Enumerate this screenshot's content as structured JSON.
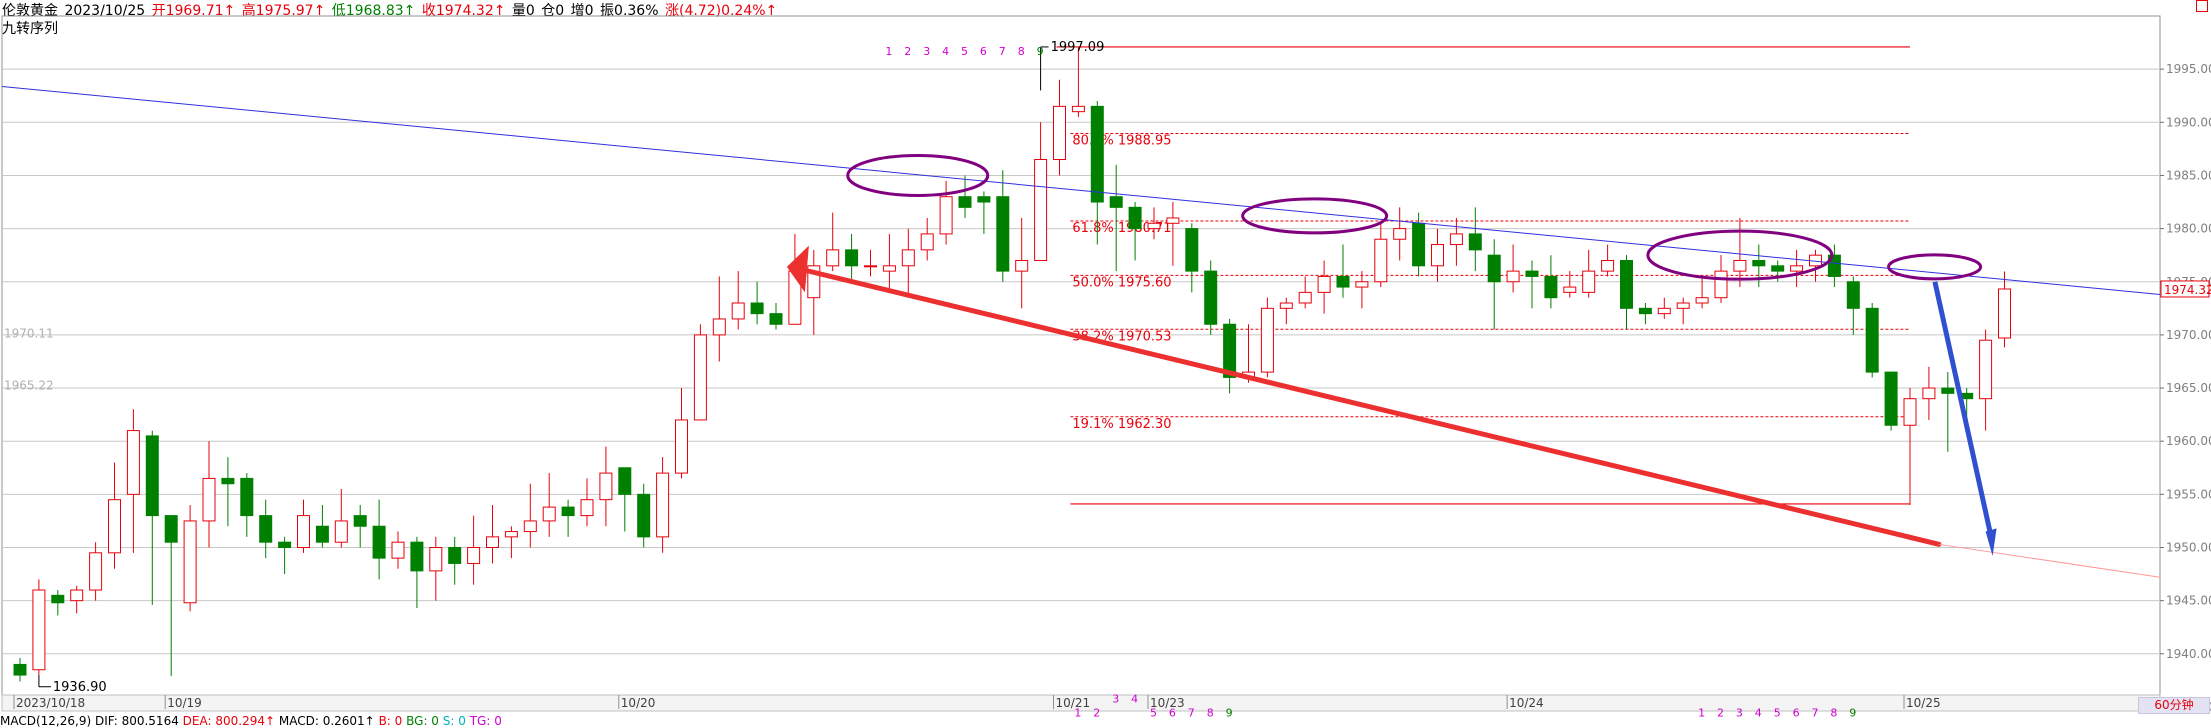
{
  "header": {
    "name": "伦敦黄金",
    "date": "2023/10/25",
    "open": "开1969.71↑",
    "high": "高1975.97↑",
    "low": "低1968.83↑",
    "close": "收1974.32↑",
    "volume": "量0",
    "position": "仓0",
    "increase": "增0",
    "amplitude": "振0.36%",
    "change": "涨(4.72)0.24%↑",
    "indicator": "九转序列"
  },
  "footer": {
    "macd": "MACD(12,26,9)",
    "dif": "DIF: 800.5164",
    "dea": "DEA: 800.294↑",
    "macd_val": "MACD: 0.2601↑",
    "b": "B: 0",
    "bg": "BG: 0",
    "s": "S: 0",
    "tg": "TG: 0"
  },
  "timeframe": "60分钟",
  "colors": {
    "up": "#e8000b",
    "down": "#008000",
    "trendline": "#3030e0",
    "ellipse": "#800080",
    "fib": "#e8000b",
    "seq_up": "#d000d0",
    "seq_down": "#008000"
  },
  "chart_data": {
    "type": "candlestick",
    "symbol": "伦敦黄金",
    "interval": "60分钟",
    "ylim": [
      1933.0,
      2000.0
    ],
    "y_ticks": [
      1935.0,
      1940.0,
      1945.0,
      1950.0,
      1955.0,
      1960.0,
      1965.0,
      1970.0,
      1975.0,
      1980.0,
      1985.0,
      1990.0,
      1995.0
    ],
    "x_labels": [
      {
        "i": 0,
        "label": "2023/10/18"
      },
      {
        "i": 8,
        "label": "10/19"
      },
      {
        "i": 32,
        "label": "10/20"
      },
      {
        "i": 55,
        "label": "10/21"
      },
      {
        "i": 60,
        "label": "10/23"
      },
      {
        "i": 79,
        "label": "10/24"
      },
      {
        "i": 100,
        "label": "10/25"
      }
    ],
    "candles": [
      [
        1939.0,
        1938.0,
        1939.6,
        1937.4
      ],
      [
        1938.5,
        1946.0,
        1947.0,
        1938.0
      ],
      [
        1945.5,
        1944.8,
        1946.0,
        1943.6
      ],
      [
        1945.0,
        1946.0,
        1946.4,
        1943.8
      ],
      [
        1946.0,
        1949.5,
        1950.5,
        1945.0
      ],
      [
        1949.5,
        1954.5,
        1958.0,
        1948.0
      ],
      [
        1955.0,
        1961.0,
        1963.0,
        1949.5
      ],
      [
        1960.5,
        1953.0,
        1961.0,
        1944.6
      ],
      [
        1953.0,
        1950.5,
        1952.0,
        1937.9
      ],
      [
        1944.8,
        1952.5,
        1954.0,
        1944.0
      ],
      [
        1952.5,
        1956.5,
        1960.0,
        1950.0
      ],
      [
        1956.5,
        1956.0,
        1958.5,
        1952.0
      ],
      [
        1956.5,
        1953.0,
        1957.0,
        1951.0
      ],
      [
        1953.0,
        1950.5,
        1954.5,
        1949.0
      ],
      [
        1950.5,
        1950.0,
        1951.0,
        1947.5
      ],
      [
        1950.0,
        1953.0,
        1954.5,
        1949.5
      ],
      [
        1952.0,
        1950.5,
        1954.0,
        1950.0
      ],
      [
        1950.5,
        1952.5,
        1955.5,
        1950.0
      ],
      [
        1953.0,
        1952.0,
        1954.0,
        1950.0
      ],
      [
        1952.0,
        1949.0,
        1954.5,
        1947.0
      ],
      [
        1949.0,
        1950.5,
        1951.5,
        1948.0
      ],
      [
        1950.5,
        1947.8,
        1951.0,
        1944.3
      ],
      [
        1947.8,
        1950.0,
        1951.0,
        1945.0
      ],
      [
        1950.0,
        1948.5,
        1951.0,
        1946.5
      ],
      [
        1948.5,
        1950.0,
        1953.0,
        1946.5
      ],
      [
        1950.0,
        1951.0,
        1954.0,
        1948.5
      ],
      [
        1951.0,
        1951.5,
        1952.0,
        1949.0
      ],
      [
        1951.5,
        1952.5,
        1956.0,
        1950.0
      ],
      [
        1952.5,
        1953.8,
        1957.0,
        1951.0
      ],
      [
        1953.8,
        1953.0,
        1954.5,
        1951.0
      ],
      [
        1953.0,
        1954.5,
        1956.5,
        1952.0
      ],
      [
        1954.5,
        1957.0,
        1959.5,
        1952.0
      ],
      [
        1957.5,
        1955.0,
        1957.5,
        1951.5
      ],
      [
        1955.0,
        1951.0,
        1956.0,
        1950.0
      ],
      [
        1951.0,
        1957.0,
        1958.5,
        1949.5
      ],
      [
        1957.0,
        1962.0,
        1965.0,
        1956.5
      ],
      [
        1962.0,
        1970.0,
        1971.0,
        1962.0
      ],
      [
        1970.0,
        1971.5,
        1975.5,
        1967.5
      ],
      [
        1971.5,
        1973.0,
        1976.0,
        1970.5
      ],
      [
        1973.0,
        1972.0,
        1975.0,
        1971.0
      ],
      [
        1972.0,
        1971.0,
        1973.0,
        1970.5
      ],
      [
        1971.0,
        1976.0,
        1979.5,
        1971.0
      ],
      [
        1973.5,
        1976.5,
        1978.0,
        1970.0
      ],
      [
        1976.5,
        1978.0,
        1981.5,
        1976.0
      ],
      [
        1978.0,
        1976.5,
        1979.5,
        1975.0
      ],
      [
        1976.5,
        1976.5,
        1978.0,
        1975.5
      ],
      [
        1976.0,
        1976.5,
        1979.5,
        1974.0
      ],
      [
        1976.5,
        1978.0,
        1980.0,
        1973.5
      ],
      [
        1978.0,
        1979.5,
        1981.0,
        1977.0
      ],
      [
        1979.5,
        1983.0,
        1984.5,
        1978.5
      ],
      [
        1983.0,
        1982.0,
        1985.0,
        1981.0
      ],
      [
        1983.0,
        1982.5,
        1983.5,
        1979.5
      ],
      [
        1983.0,
        1976.0,
        1985.5,
        1975.0
      ],
      [
        1976.0,
        1977.0,
        1981.0,
        1972.5
      ],
      [
        1977.0,
        1986.5,
        1990.0,
        1977.5
      ],
      [
        1986.5,
        1991.5,
        1994.0,
        1985.0
      ],
      [
        1991.0,
        1991.5,
        1997.09,
        1990.5
      ],
      [
        1991.5,
        1982.5,
        1992.0,
        1978.5
      ],
      [
        1983.0,
        1982.0,
        1986.0,
        1976.0
      ],
      [
        1982.0,
        1980.0,
        1982.5,
        1977.0
      ],
      [
        1980.0,
        1980.5,
        1982.0,
        1979.0
      ],
      [
        1980.5,
        1981.0,
        1982.5,
        1976.5
      ],
      [
        1980.0,
        1976.0,
        1980.5,
        1974.0
      ],
      [
        1976.0,
        1971.0,
        1977.0,
        1970.0
      ],
      [
        1971.0,
        1966.0,
        1971.5,
        1964.5
      ],
      [
        1966.0,
        1966.5,
        1971.0,
        1965.5
      ],
      [
        1966.5,
        1972.5,
        1973.5,
        1966.0
      ],
      [
        1972.5,
        1973.0,
        1973.5,
        1971.0
      ],
      [
        1973.0,
        1974.0,
        1975.5,
        1972.5
      ],
      [
        1974.0,
        1975.5,
        1977.0,
        1972.0
      ],
      [
        1975.5,
        1974.5,
        1978.5,
        1973.5
      ],
      [
        1974.5,
        1975.0,
        1976.0,
        1972.5
      ],
      [
        1975.0,
        1979.0,
        1980.5,
        1974.5
      ],
      [
        1979.0,
        1980.0,
        1982.0,
        1977.0
      ],
      [
        1980.5,
        1976.5,
        1981.5,
        1975.5
      ],
      [
        1976.5,
        1978.5,
        1980.0,
        1975.0
      ],
      [
        1978.5,
        1979.5,
        1981.0,
        1976.5
      ],
      [
        1979.5,
        1978.0,
        1982.0,
        1976.0
      ],
      [
        1977.5,
        1975.0,
        1979.0,
        1970.5
      ],
      [
        1975.0,
        1976.0,
        1978.5,
        1974.0
      ],
      [
        1976.0,
        1975.5,
        1977.0,
        1972.5
      ],
      [
        1975.5,
        1973.5,
        1977.5,
        1972.5
      ],
      [
        1974.0,
        1974.5,
        1976.0,
        1973.5
      ],
      [
        1974.0,
        1976.0,
        1978.0,
        1973.5
      ],
      [
        1976.0,
        1977.0,
        1978.5,
        1975.5
      ],
      [
        1977.0,
        1972.5,
        1977.5,
        1970.5
      ],
      [
        1972.5,
        1972.0,
        1973.0,
        1971.0
      ],
      [
        1972.0,
        1972.5,
        1973.5,
        1971.5
      ],
      [
        1972.5,
        1973.0,
        1973.5,
        1971.0
      ],
      [
        1973.0,
        1973.5,
        1975.5,
        1972.5
      ],
      [
        1973.5,
        1976.0,
        1977.5,
        1973.0
      ],
      [
        1976.0,
        1977.0,
        1981.0,
        1974.5
      ],
      [
        1977.0,
        1976.5,
        1978.5,
        1974.5
      ],
      [
        1976.5,
        1976.0,
        1977.0,
        1975.0
      ],
      [
        1976.0,
        1976.5,
        1978.0,
        1974.5
      ],
      [
        1976.5,
        1977.5,
        1978.0,
        1975.0
      ],
      [
        1977.5,
        1975.5,
        1978.5,
        1974.5
      ],
      [
        1975.0,
        1972.5,
        1975.5,
        1970.0
      ],
      [
        1972.5,
        1966.5,
        1973.0,
        1966.0
      ],
      [
        1966.5,
        1961.5,
        1966.5,
        1961.0
      ],
      [
        1961.5,
        1964.0,
        1965.0,
        1954.0
      ],
      [
        1964.0,
        1965.0,
        1967.0,
        1962.0
      ],
      [
        1965.0,
        1964.5,
        1966.5,
        1959.0
      ],
      [
        1964.5,
        1964.0,
        1965.0,
        1961.0
      ],
      [
        1964.0,
        1969.5,
        1970.5,
        1961.0
      ],
      [
        1969.71,
        1974.32,
        1975.97,
        1968.83
      ]
    ],
    "annotations": {
      "high_label": "1997.09",
      "low_label": "1936.90",
      "left_axis_labels": [
        "1970.11",
        "1965.22"
      ],
      "last_price": "1974.32",
      "fib_levels": [
        {
          "label": "80.9% 1988.95",
          "value": 1988.95
        },
        {
          "label": "61.8% 1980.71",
          "value": 1980.71
        },
        {
          "label": "50.0% 1975.60",
          "value": 1975.6
        },
        {
          "label": "38.2% 1970.53",
          "value": 1970.53
        },
        {
          "label": "19.1% 1962.30",
          "value": 1962.3
        }
      ],
      "fib_high": 1997.09,
      "fib_low": 1954.1,
      "td_sequences": [
        {
          "start": 46,
          "labels": [
            "1",
            "2",
            "3",
            "4",
            "5",
            "6",
            "7",
            "8",
            "9"
          ],
          "position": "top"
        },
        {
          "start": 56,
          "labels": [
            "1",
            "2",
            "3",
            "4",
            "5",
            "6",
            "7",
            "8",
            "9"
          ],
          "position": "bottom"
        },
        {
          "start": 89,
          "labels": [
            "1",
            "2",
            "3",
            "4",
            "5",
            "6",
            "7",
            "8",
            "9"
          ],
          "position": "bottom"
        }
      ]
    }
  }
}
